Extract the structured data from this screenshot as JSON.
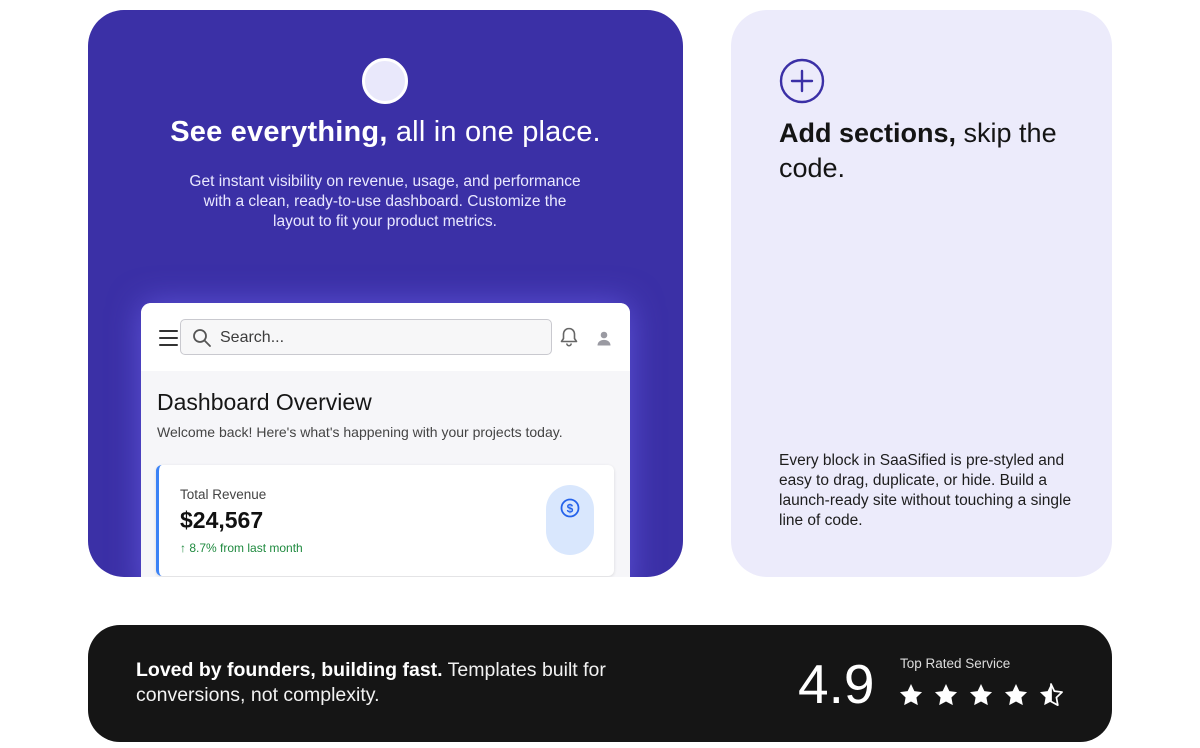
{
  "feature_card": {
    "heading_bold": "See everything,",
    "heading_rest": " all in one place.",
    "description": "Get instant visibility on revenue, usage, and performance with a clean, ready-to-use dashboard. Customize the layout to fit your product metrics."
  },
  "dashboard": {
    "search_placeholder": "Search...",
    "title": "Dashboard Overview",
    "subtitle": "Welcome back! Here's what's happening with your projects today.",
    "revenue_card": {
      "label": "Total Revenue",
      "value": "$24,567",
      "change": "8.7% from last month",
      "change_arrow": "↑"
    }
  },
  "sections_card": {
    "heading_bold": "Add sections,",
    "heading_rest": " skip the code.",
    "description": "Every block in SaaSified is pre-styled and easy to drag, duplicate, or hide. Build a launch-ready site without touching a single line of code."
  },
  "banner": {
    "text_bold": "Loved by founders, building fast.",
    "text_rest": " Templates built for conversions, not complexity.",
    "rating": "4.9",
    "rating_label": "Top Rated Service",
    "stars": 4.5
  },
  "colors": {
    "feature_bg": "#3b30a6",
    "sections_bg": "#ecebfb",
    "banner_bg": "#151515",
    "accent_blue": "#3b82f6",
    "positive_green": "#1f8a3f"
  }
}
